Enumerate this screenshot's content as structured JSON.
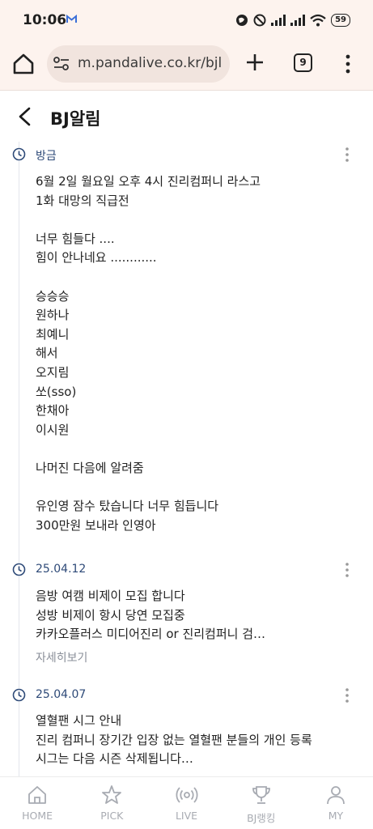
{
  "status_bar": {
    "time": "10:06",
    "battery": "59"
  },
  "browser": {
    "url": "m.pandalive.co.kr/bjl",
    "tab_count": "9"
  },
  "page": {
    "title": "BJ알림"
  },
  "entries": [
    {
      "date": "방금",
      "body": "6월 2일 월요일 오후 4시 진리컴퍼니 라스고\n1화 대망의 직급전\n\n너무 힘들다 ....\n힘이 안나네요 ............\n\n승승승\n원하나\n최예니\n해서\n오지림\n쏘(sso)\n한채아\n이시원\n\n나머진 다음에 알려줌\n\n유인영 잠수 탔습니다 너무 힘듭니다\n300만원 보내라 인영아"
    },
    {
      "date": "25.04.12",
      "body": "음방 여캠 비제이 모집 합니다\n성방 비제이 항시 당연 모집중\n카카오플러스 미디어진리 or 진리컴퍼니 검…",
      "more": "자세히보기"
    },
    {
      "date": "25.04.07",
      "body": "열혈팬 시그 안내\n진리 컴퍼니 장기간 입장 없는 열혈팬 분들의 개인 등록\n시그는 다음 시즌 삭제됩니다…"
    }
  ],
  "bottom_nav": [
    {
      "label": "HOME",
      "icon": "home-icon"
    },
    {
      "label": "PICK",
      "icon": "star-icon"
    },
    {
      "label": "LIVE",
      "icon": "live-broadcast-icon"
    },
    {
      "label": "BJ랭킹",
      "icon": "trophy-icon"
    },
    {
      "label": "MY",
      "icon": "person-icon"
    }
  ]
}
